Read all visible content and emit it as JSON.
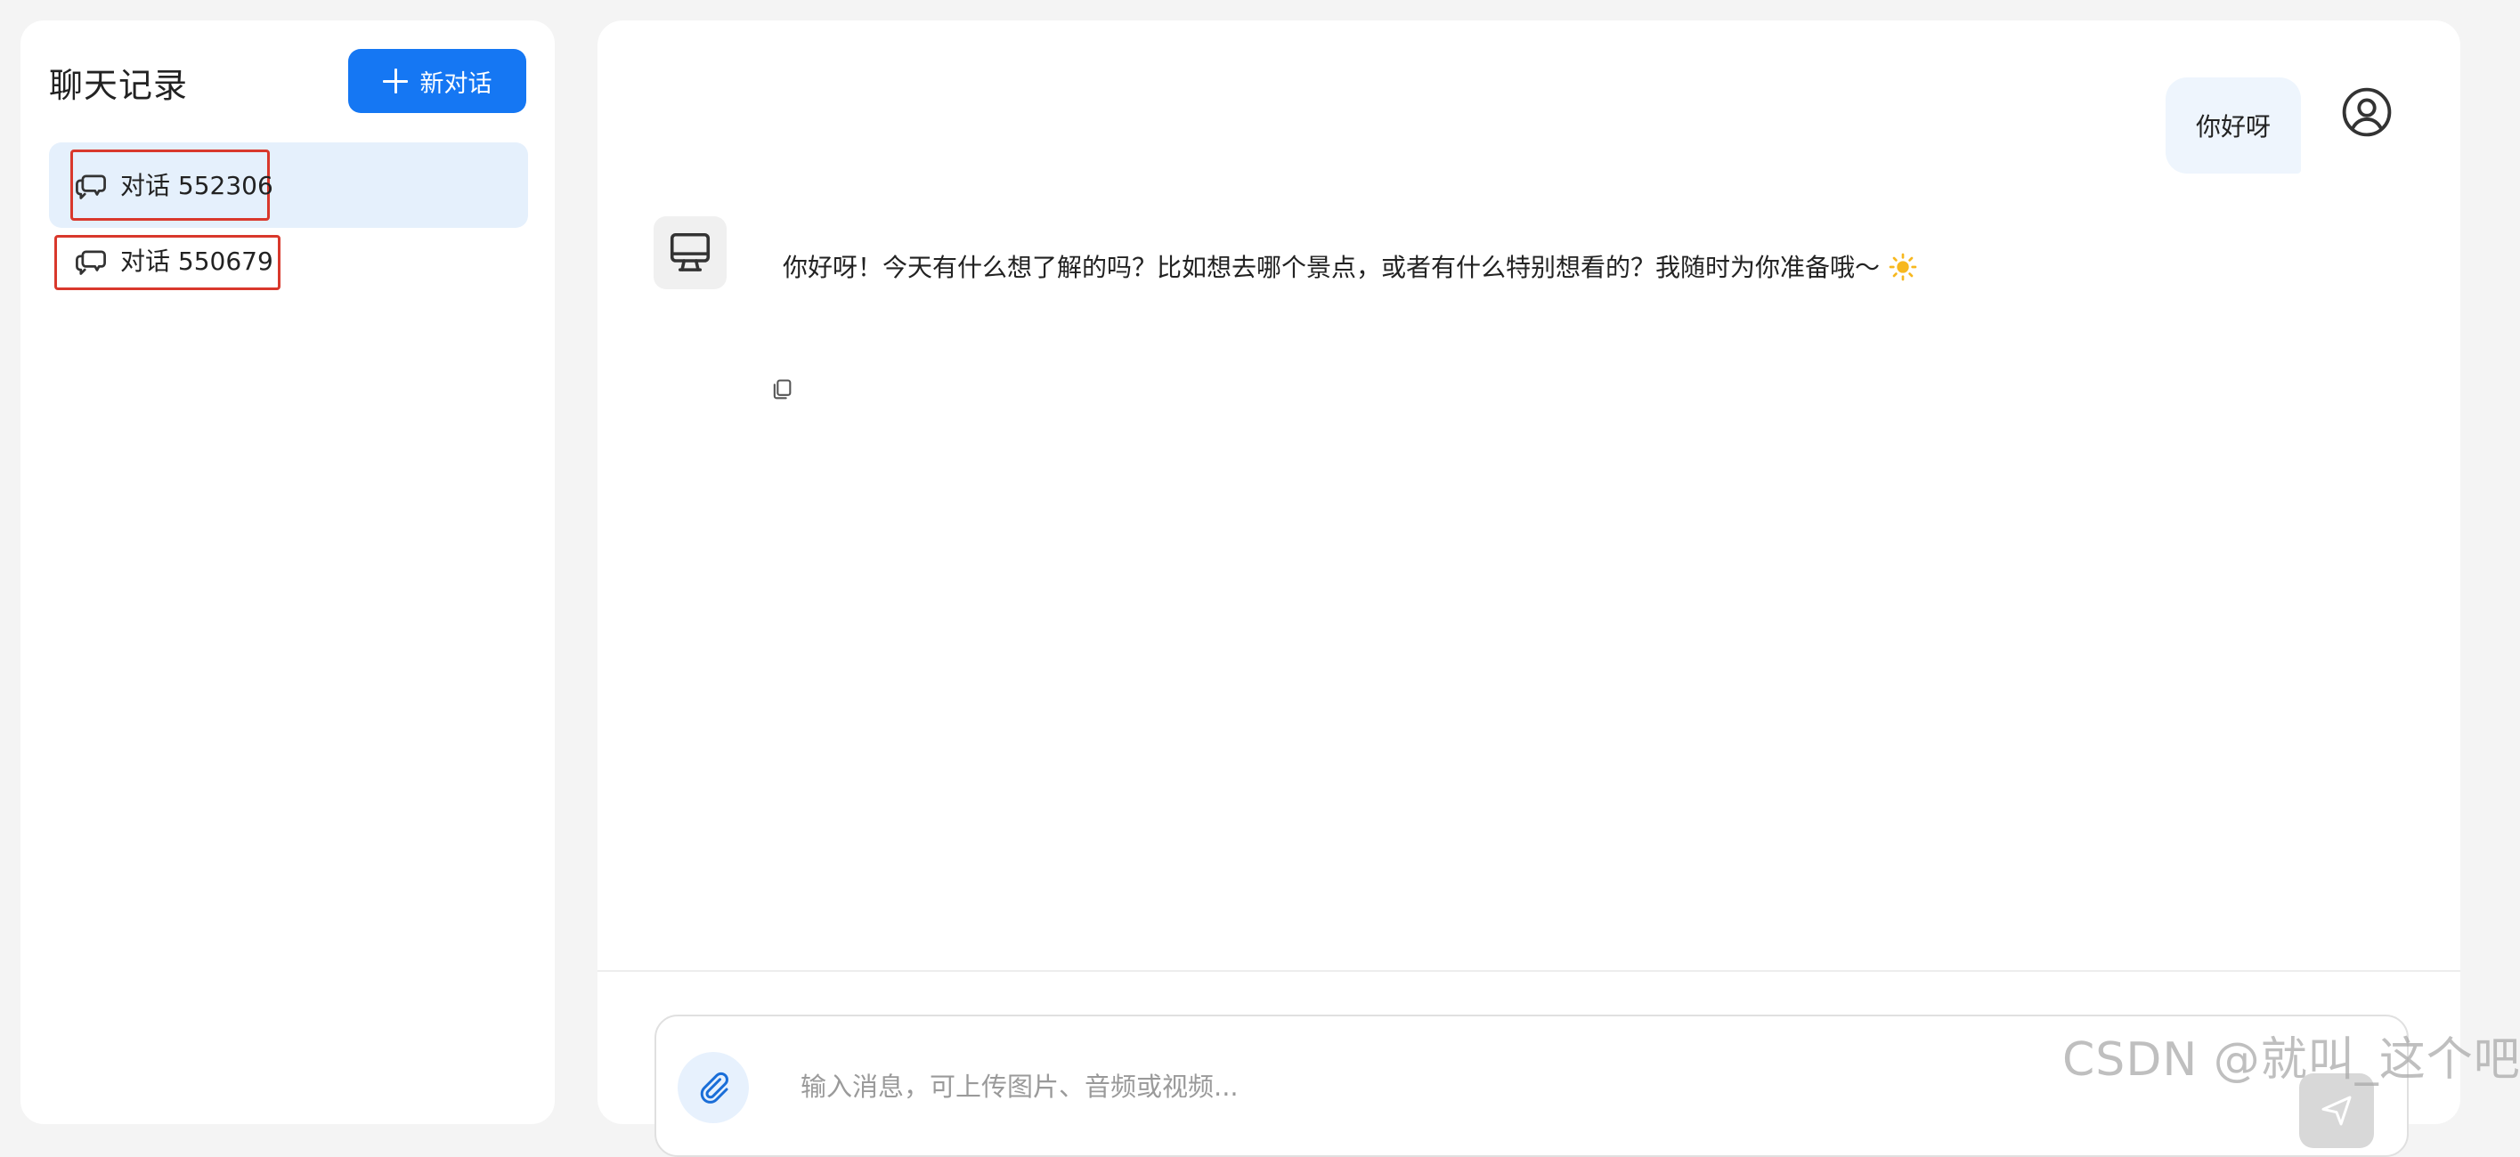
{
  "sidebar": {
    "title": "聊天记录",
    "new_chat_label": "新对话",
    "conversations": [
      {
        "label": "对话 552306",
        "active": true
      },
      {
        "label": "对话 550679",
        "active": false
      }
    ]
  },
  "chat": {
    "messages": [
      {
        "role": "user",
        "text": "你好呀"
      },
      {
        "role": "assistant",
        "text": "你好呀！今天有什么想了解的吗？比如想去哪个景点，或者有什么特别想看的？我随时为你准备哦～"
      }
    ]
  },
  "composer": {
    "placeholder": "输入消息，可上传图片、音频或视频..."
  },
  "watermark": "CSDN @就叫_这个吧",
  "colors": {
    "accent": "#1577f3",
    "active_item_bg": "#e5f0fc",
    "highlight_border": "#d9382c",
    "user_bubble_bg": "#eef5fd"
  },
  "icons": {
    "conversation": "chat-bubbles-icon",
    "new_chat": "plus-icon",
    "user_avatar": "user-circle-icon",
    "bot_avatar": "monitor-icon",
    "copy": "copy-icon",
    "attach": "paperclip-icon",
    "send": "send-icon",
    "emoji": "sun-icon"
  }
}
